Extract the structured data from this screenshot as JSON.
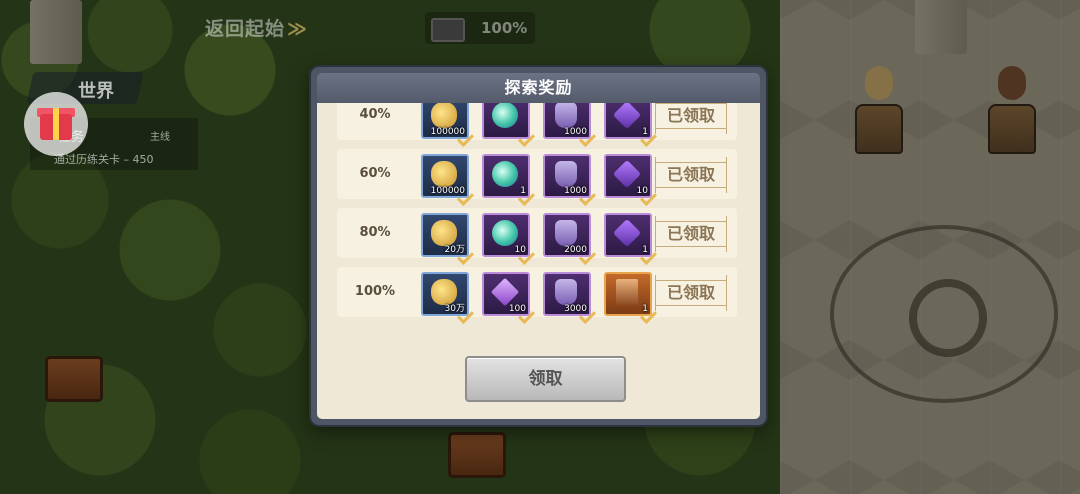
{
  "hud": {
    "return_label": "返回起始",
    "return_chevron": "≫",
    "progress": "100%"
  },
  "world_panel": {
    "world_label": "世界",
    "quest_title": "任务",
    "quest_tag": "主线",
    "quest_desc": "通过历练关卡 – 450"
  },
  "modal": {
    "title": "探索奖励",
    "claim_button": "领取",
    "rows": [
      {
        "pct": "40%",
        "status": "已领取",
        "items": [
          {
            "icon": "gold-coin-icon",
            "qty": "100000",
            "frame": "blue"
          },
          {
            "icon": "spirit-orb-icon",
            "qty": "",
            "frame": "purple"
          },
          {
            "icon": "potion-jar-icon",
            "qty": "1000",
            "frame": "purple"
          },
          {
            "icon": "purple-crystal-icon",
            "qty": "1",
            "frame": "purple"
          }
        ]
      },
      {
        "pct": "60%",
        "status": "已领取",
        "items": [
          {
            "icon": "gold-coin-icon",
            "qty": "100000",
            "frame": "blue"
          },
          {
            "icon": "spirit-orb-icon",
            "qty": "1",
            "frame": "purple"
          },
          {
            "icon": "potion-jar-icon",
            "qty": "1000",
            "frame": "purple"
          },
          {
            "icon": "purple-crystal-icon",
            "qty": "10",
            "frame": "purple"
          }
        ]
      },
      {
        "pct": "80%",
        "status": "已领取",
        "items": [
          {
            "icon": "gold-coin-icon",
            "qty": "20万",
            "frame": "blue"
          },
          {
            "icon": "spirit-orb-icon",
            "qty": "10",
            "frame": "purple"
          },
          {
            "icon": "potion-jar-icon",
            "qty": "2000",
            "frame": "purple"
          },
          {
            "icon": "purple-crystal-icon",
            "qty": "1",
            "frame": "purple"
          }
        ]
      },
      {
        "pct": "100%",
        "status": "已领取",
        "items": [
          {
            "icon": "gold-coin-icon",
            "qty": "30万",
            "frame": "blue"
          },
          {
            "icon": "purple-gem-icon",
            "qty": "100",
            "frame": "purple"
          },
          {
            "icon": "potion-jar-icon",
            "qty": "3000",
            "frame": "purple"
          },
          {
            "icon": "hero-card-icon",
            "qty": "1",
            "frame": "orange"
          }
        ]
      }
    ]
  }
}
